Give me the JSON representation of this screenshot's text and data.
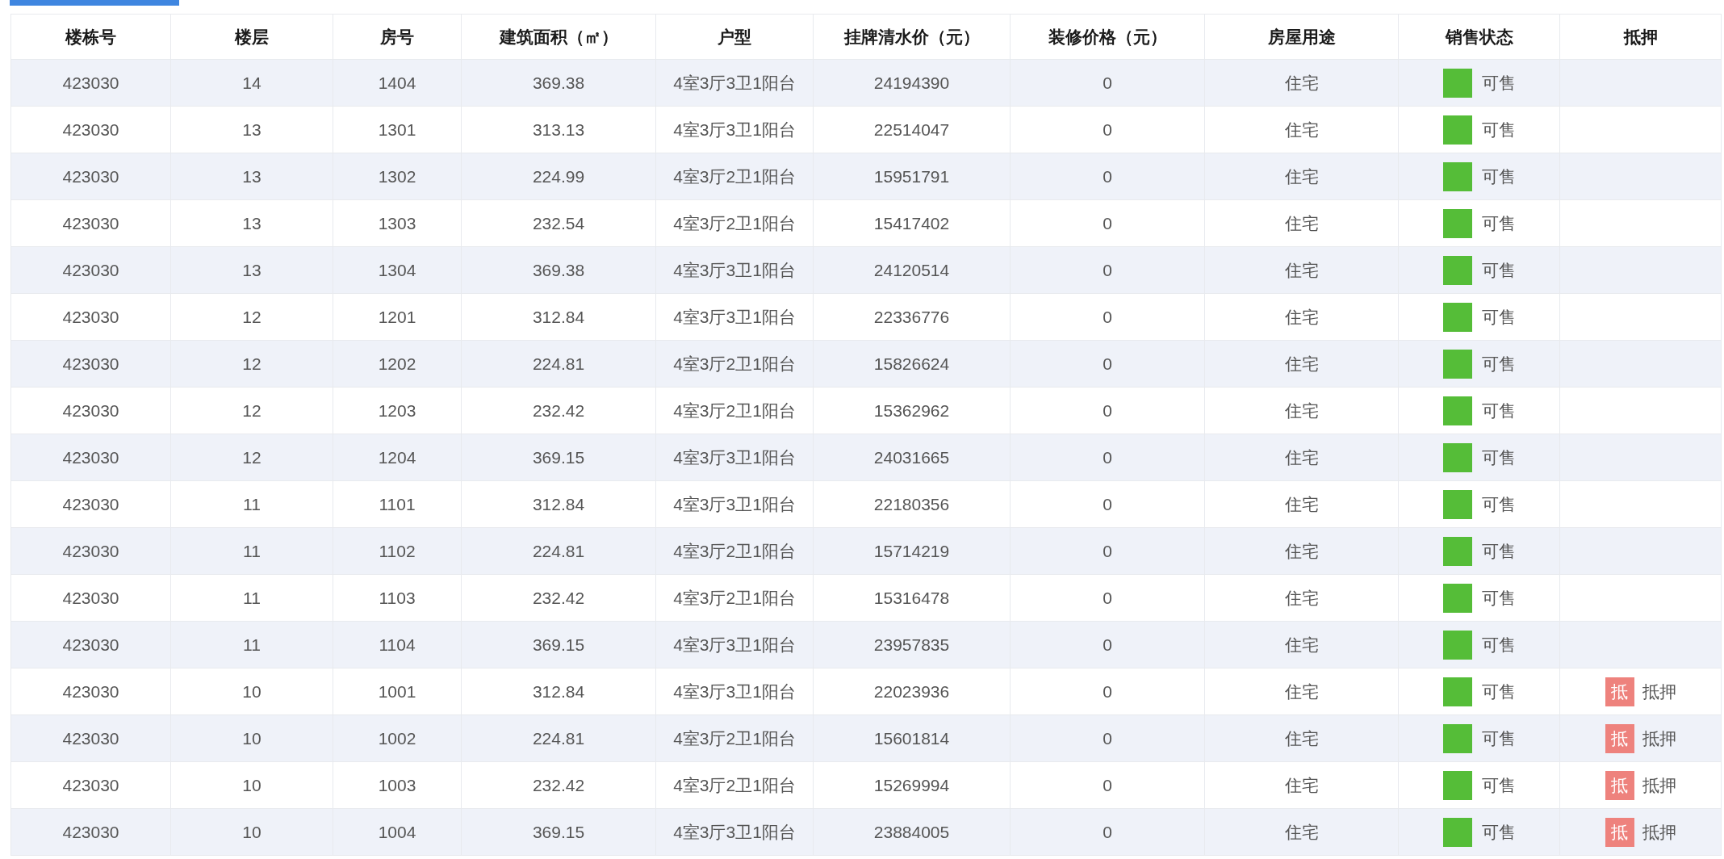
{
  "columns": [
    "楼栋号",
    "楼层",
    "房号",
    "建筑面积（㎡）",
    "户型",
    "挂牌清水价（元）",
    "装修价格（元）",
    "房屋用途",
    "销售状态",
    "抵押"
  ],
  "rows": [
    {
      "building": "423030",
      "floor": "14",
      "room": "1404",
      "area": "369.38",
      "layout": "4室3厅3卫1阳台",
      "price": "24194390",
      "decoration": "0",
      "usage": "住宅",
      "status": {
        "label": "可售",
        "color": "#55bd38"
      }
    },
    {
      "building": "423030",
      "floor": "13",
      "room": "1301",
      "area": "313.13",
      "layout": "4室3厅3卫1阳台",
      "price": "22514047",
      "decoration": "0",
      "usage": "住宅",
      "status": {
        "label": "可售",
        "color": "#55bd38"
      }
    },
    {
      "building": "423030",
      "floor": "13",
      "room": "1302",
      "area": "224.99",
      "layout": "4室3厅2卫1阳台",
      "price": "15951791",
      "decoration": "0",
      "usage": "住宅",
      "status": {
        "label": "可售",
        "color": "#55bd38"
      }
    },
    {
      "building": "423030",
      "floor": "13",
      "room": "1303",
      "area": "232.54",
      "layout": "4室3厅2卫1阳台",
      "price": "15417402",
      "decoration": "0",
      "usage": "住宅",
      "status": {
        "label": "可售",
        "color": "#55bd38"
      }
    },
    {
      "building": "423030",
      "floor": "13",
      "room": "1304",
      "area": "369.38",
      "layout": "4室3厅3卫1阳台",
      "price": "24120514",
      "decoration": "0",
      "usage": "住宅",
      "status": {
        "label": "可售",
        "color": "#55bd38"
      }
    },
    {
      "building": "423030",
      "floor": "12",
      "room": "1201",
      "area": "312.84",
      "layout": "4室3厅3卫1阳台",
      "price": "22336776",
      "decoration": "0",
      "usage": "住宅",
      "status": {
        "label": "可售",
        "color": "#55bd38"
      }
    },
    {
      "building": "423030",
      "floor": "12",
      "room": "1202",
      "area": "224.81",
      "layout": "4室3厅2卫1阳台",
      "price": "15826624",
      "decoration": "0",
      "usage": "住宅",
      "status": {
        "label": "可售",
        "color": "#55bd38"
      }
    },
    {
      "building": "423030",
      "floor": "12",
      "room": "1203",
      "area": "232.42",
      "layout": "4室3厅2卫1阳台",
      "price": "15362962",
      "decoration": "0",
      "usage": "住宅",
      "status": {
        "label": "可售",
        "color": "#55bd38"
      }
    },
    {
      "building": "423030",
      "floor": "12",
      "room": "1204",
      "area": "369.15",
      "layout": "4室3厅3卫1阳台",
      "price": "24031665",
      "decoration": "0",
      "usage": "住宅",
      "status": {
        "label": "可售",
        "color": "#55bd38"
      }
    },
    {
      "building": "423030",
      "floor": "11",
      "room": "1101",
      "area": "312.84",
      "layout": "4室3厅3卫1阳台",
      "price": "22180356",
      "decoration": "0",
      "usage": "住宅",
      "status": {
        "label": "可售",
        "color": "#55bd38"
      }
    },
    {
      "building": "423030",
      "floor": "11",
      "room": "1102",
      "area": "224.81",
      "layout": "4室3厅2卫1阳台",
      "price": "15714219",
      "decoration": "0",
      "usage": "住宅",
      "status": {
        "label": "可售",
        "color": "#55bd38"
      }
    },
    {
      "building": "423030",
      "floor": "11",
      "room": "1103",
      "area": "232.42",
      "layout": "4室3厅2卫1阳台",
      "price": "15316478",
      "decoration": "0",
      "usage": "住宅",
      "status": {
        "label": "可售",
        "color": "#55bd38"
      }
    },
    {
      "building": "423030",
      "floor": "11",
      "room": "1104",
      "area": "369.15",
      "layout": "4室3厅3卫1阳台",
      "price": "23957835",
      "decoration": "0",
      "usage": "住宅",
      "status": {
        "label": "可售",
        "color": "#55bd38"
      }
    },
    {
      "building": "423030",
      "floor": "10",
      "room": "1001",
      "area": "312.84",
      "layout": "4室3厅3卫1阳台",
      "price": "22023936",
      "decoration": "0",
      "usage": "住宅",
      "status": {
        "label": "可售",
        "color": "#55bd38"
      },
      "mortgage": {
        "badge": "抵",
        "label": "抵押"
      }
    },
    {
      "building": "423030",
      "floor": "10",
      "room": "1002",
      "area": "224.81",
      "layout": "4室3厅2卫1阳台",
      "price": "15601814",
      "decoration": "0",
      "usage": "住宅",
      "status": {
        "label": "可售",
        "color": "#55bd38"
      },
      "mortgage": {
        "badge": "抵",
        "label": "抵押"
      }
    },
    {
      "building": "423030",
      "floor": "10",
      "room": "1003",
      "area": "232.42",
      "layout": "4室3厅2卫1阳台",
      "price": "15269994",
      "decoration": "0",
      "usage": "住宅",
      "status": {
        "label": "可售",
        "color": "#55bd38"
      },
      "mortgage": {
        "badge": "抵",
        "label": "抵押"
      }
    },
    {
      "building": "423030",
      "floor": "10",
      "room": "1004",
      "area": "369.15",
      "layout": "4室3厅3卫1阳台",
      "price": "23884005",
      "decoration": "0",
      "usage": "住宅",
      "status": {
        "label": "可售",
        "color": "#55bd38"
      },
      "mortgage": {
        "badge": "抵",
        "label": "抵押"
      }
    }
  ]
}
